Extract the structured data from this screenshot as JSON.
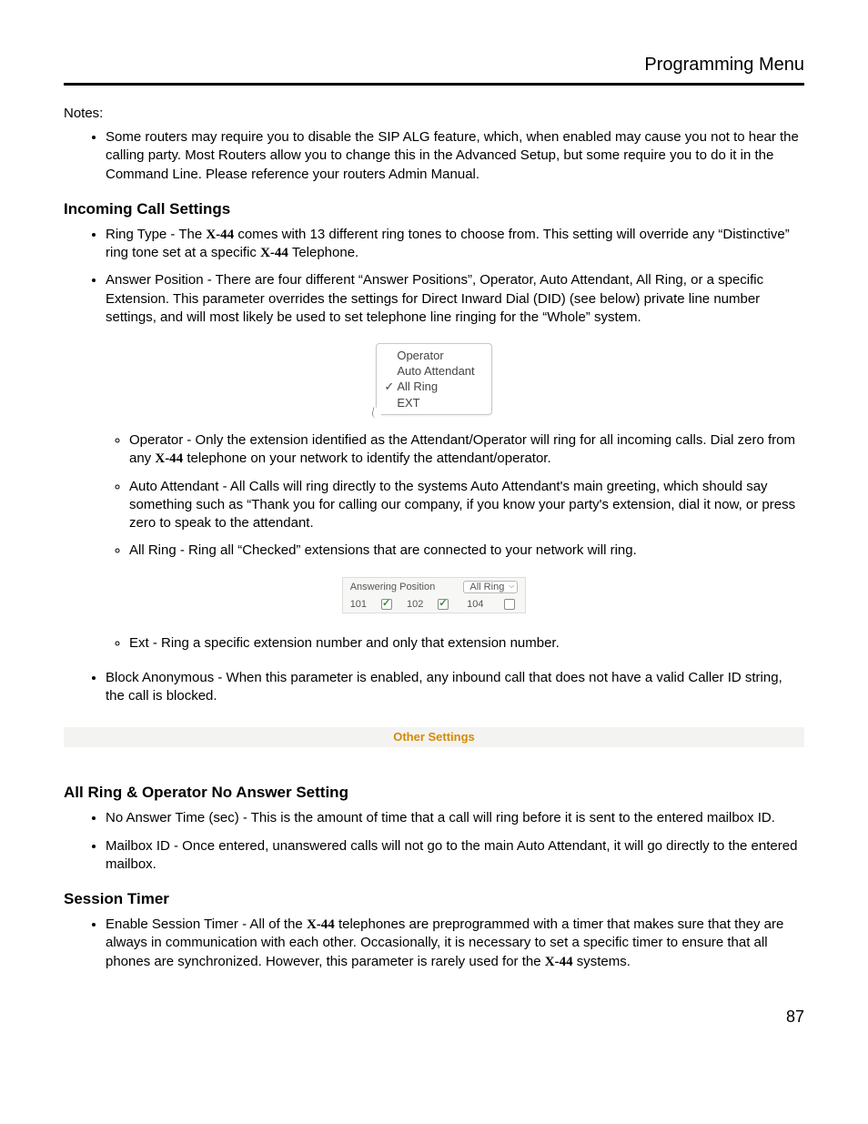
{
  "header": {
    "title": "Programming Menu"
  },
  "notes_label": "Notes:",
  "notes": {
    "item1": "Some routers may require you to disable the SIP ALG feature, which, when enabled may cause you not to hear the calling party.  Most Routers allow you to change this in the Advanced Setup, but some require you to do it in the Command Line. Please reference your routers Admin Manual."
  },
  "incoming": {
    "heading": "Incoming Call Settings",
    "ring_type_a": "Ring Type - The ",
    "ring_type_b": " comes with 13 different ring tones to choose from. This setting will override any “Distinctive” ring tone set at a specific ",
    "ring_type_c": " Telephone.",
    "answer_pos": "Answer Position - There are four different “Answer Positions”, Operator, Auto Attendant, All Ring, or a specific Extension. This parameter overrides the settings for Direct Inward Dial (DID) (see below) private line number settings, and will most likely be used to set telephone line ringing for the “Whole” system.",
    "dropdown": {
      "opt1": "Operator",
      "opt2": "Auto Attendant",
      "opt3": "All Ring",
      "opt4": "EXT"
    },
    "operator_a": "Operator - Only the extension identified as the Attendant/Operator will ring for all incoming calls. Dial zero from any ",
    "operator_b": " telephone on your network to identify the attendant/operator.",
    "auto_att": "Auto Attendant - All Calls will ring directly to the systems Auto Attendant's main greeting, which should say something such as “Thank you for calling our company, if you know your party's extension, dial it now, or press zero to speak to the attendant.",
    "all_ring": "All Ring - Ring all “Checked” extensions that are connected to your network will ring.",
    "table": {
      "label": "Answering Position",
      "select": "All Ring",
      "c1": "101",
      "c2": "102",
      "c3": "104"
    },
    "ext": "Ext - Ring a specific extension number and only that extension number.",
    "block_anon": "Block Anonymous - When this parameter is enabled, any inbound call that does not have a valid Caller ID string, the call is blocked."
  },
  "other_settings": "Other Settings",
  "allring": {
    "heading": "All Ring & Operator No Answer Setting",
    "noanswer": "No Answer Time (sec) - This is the amount of time that a call will ring before it is sent to the entered mailbox ID.",
    "mailbox": "Mailbox ID - Once entered, unanswered calls will not go to the main Auto Attendant, it will go directly to the entered mailbox."
  },
  "session": {
    "heading": "Session Timer",
    "text_a": "Enable Session Timer - All of the ",
    "text_b": " telephones are preprogrammed with a timer that makes sure that they are always in communication with each other. Occasionally, it is necessary to set a specific timer to ensure that all phones are synchronized.  However, this parameter is rarely used for the ",
    "text_c": " systems."
  },
  "model": "X-44",
  "page_number": "87"
}
